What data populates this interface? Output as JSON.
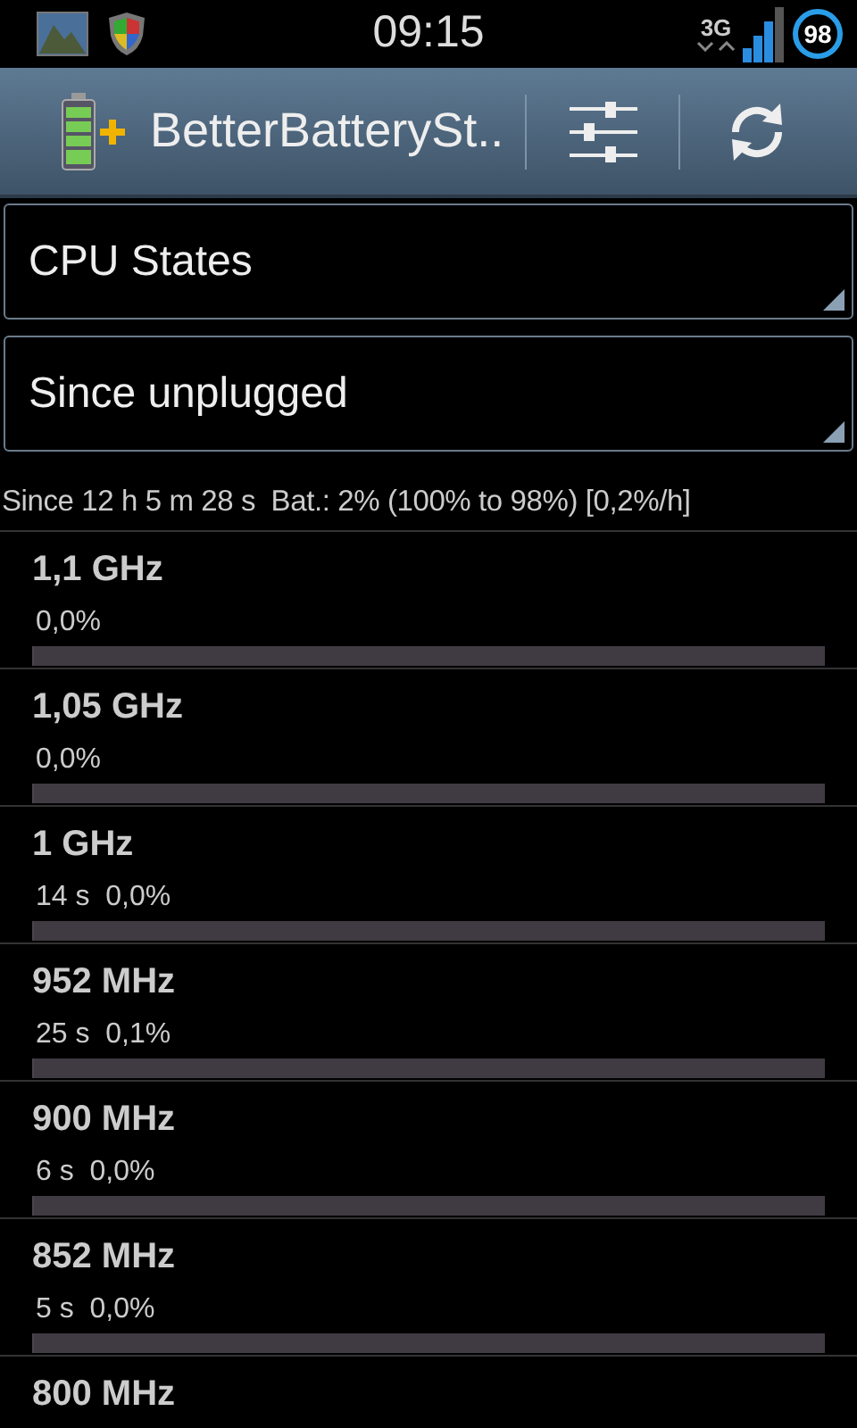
{
  "status_bar": {
    "time": "09:15",
    "network": "3G",
    "battery": "98"
  },
  "action_bar": {
    "title": "BetterBatterySt.."
  },
  "spinners": [
    {
      "value": "CPU States"
    },
    {
      "value": "Since unplugged"
    }
  ],
  "summary": "Since 12 h 5 m 28 s  Bat.: 2% (100% to 98%) [0,2%/h]",
  "states": [
    {
      "name": "1,1 GHz",
      "detail": "0,0%",
      "level": 0
    },
    {
      "name": "1,05 GHz",
      "detail": "0,0%",
      "level": 0
    },
    {
      "name": "1 GHz",
      "detail": "14 s  0,0%",
      "level": 0
    },
    {
      "name": "952 MHz",
      "detail": "25 s  0,1%",
      "level": 0.001
    },
    {
      "name": "900 MHz",
      "detail": "6 s  0,0%",
      "level": 0
    },
    {
      "name": "852 MHz",
      "detail": "5 s  0,0%",
      "level": 0
    },
    {
      "name": "800 MHz"
    }
  ]
}
